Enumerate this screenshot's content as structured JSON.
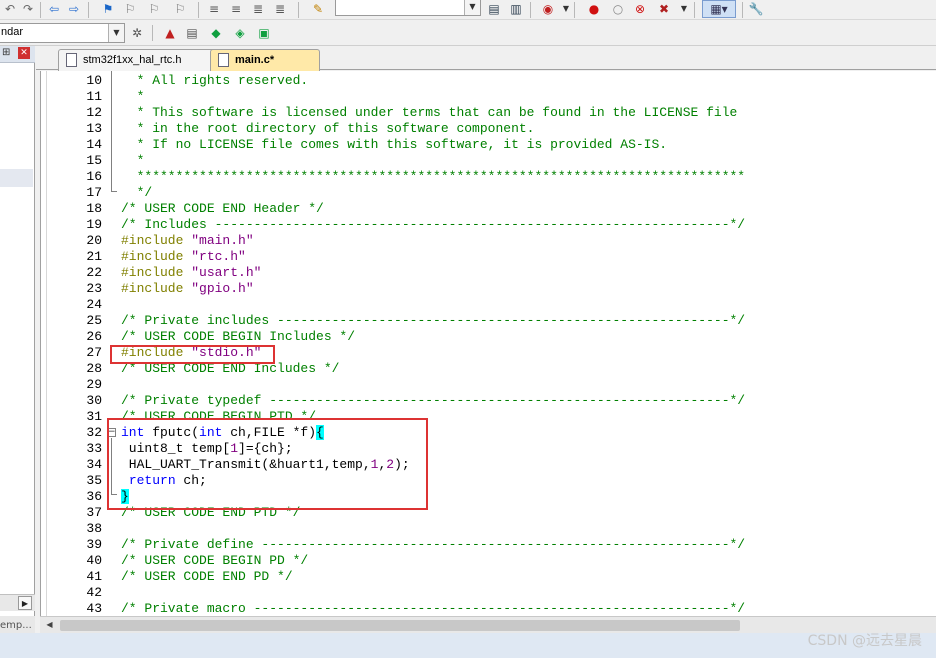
{
  "toolbar": {
    "target_combo": "ndar"
  },
  "tabs": [
    {
      "label": "stm32f1xx_hal_rtc.h"
    },
    {
      "label": "main.c*"
    }
  ],
  "left_panel": {
    "footer": "emp..."
  },
  "editor": {
    "lines": [
      {
        "n": "10",
        "code": [
          {
            "t": "  * All rights reserved.",
            "c": "c-cmt"
          }
        ]
      },
      {
        "n": "11",
        "code": [
          {
            "t": "  *",
            "c": "c-cmt"
          }
        ]
      },
      {
        "n": "12",
        "code": [
          {
            "t": "  * This software is licensed under terms that can be found in the LICENSE file",
            "c": "c-cmt"
          }
        ]
      },
      {
        "n": "13",
        "code": [
          {
            "t": "  * in the root directory of this software component.",
            "c": "c-cmt"
          }
        ]
      },
      {
        "n": "14",
        "code": [
          {
            "t": "  * If no LICENSE file comes with this software, it is provided AS-IS.",
            "c": "c-cmt"
          }
        ]
      },
      {
        "n": "15",
        "code": [
          {
            "t": "  *",
            "c": "c-cmt"
          }
        ]
      },
      {
        "n": "16",
        "code": [
          {
            "t": "  ******************************************************************************",
            "c": "c-cmt"
          }
        ]
      },
      {
        "n": "17",
        "code": [
          {
            "t": "  */",
            "c": "c-cmt"
          }
        ]
      },
      {
        "n": "18",
        "code": [
          {
            "t": "/* USER CODE END Header */",
            "c": "c-cmt"
          }
        ]
      },
      {
        "n": "19",
        "code": [
          {
            "t": "/* Includes ------------------------------------------------------------------*/",
            "c": "c-cmt"
          }
        ]
      },
      {
        "n": "20",
        "code": [
          {
            "t": "#include ",
            "c": "c-pp"
          },
          {
            "t": "\"main.h\"",
            "c": "c-str"
          }
        ]
      },
      {
        "n": "21",
        "code": [
          {
            "t": "#include ",
            "c": "c-pp"
          },
          {
            "t": "\"rtc.h\"",
            "c": "c-str"
          }
        ]
      },
      {
        "n": "22",
        "code": [
          {
            "t": "#include ",
            "c": "c-pp"
          },
          {
            "t": "\"usart.h\"",
            "c": "c-str"
          }
        ]
      },
      {
        "n": "23",
        "code": [
          {
            "t": "#include ",
            "c": "c-pp"
          },
          {
            "t": "\"gpio.h\"",
            "c": "c-str"
          }
        ]
      },
      {
        "n": "24",
        "code": []
      },
      {
        "n": "25",
        "code": [
          {
            "t": "/* Private includes ----------------------------------------------------------*/",
            "c": "c-cmt"
          }
        ]
      },
      {
        "n": "26",
        "code": [
          {
            "t": "/* USER CODE BEGIN Includes */",
            "c": "c-cmt"
          }
        ]
      },
      {
        "n": "27",
        "code": [
          {
            "t": "#include ",
            "c": "c-pp"
          },
          {
            "t": "\"stdio.h\"",
            "c": "c-str"
          }
        ]
      },
      {
        "n": "28",
        "code": [
          {
            "t": "/* USER CODE END Includes */",
            "c": "c-cmt"
          }
        ]
      },
      {
        "n": "29",
        "code": []
      },
      {
        "n": "30",
        "code": [
          {
            "t": "/* Private typedef -----------------------------------------------------------*/",
            "c": "c-cmt"
          }
        ]
      },
      {
        "n": "31",
        "code": [
          {
            "t": "/* USER CODE BEGIN PTD */",
            "c": "c-cmt"
          }
        ]
      },
      {
        "n": "32",
        "code": [
          {
            "t": "int",
            "c": "c-kw"
          },
          {
            "t": " fputc(",
            "c": ""
          },
          {
            "t": "int",
            "c": "c-kw"
          },
          {
            "t": " ch,FILE *f)",
            "c": ""
          },
          {
            "t": "{",
            "c": "c-br"
          }
        ]
      },
      {
        "n": "33",
        "code": [
          {
            "t": " uint8_t temp[",
            "c": ""
          },
          {
            "t": "1",
            "c": "c-num"
          },
          {
            "t": "]={ch};",
            "c": ""
          }
        ]
      },
      {
        "n": "34",
        "code": [
          {
            "t": " HAL_UART_Transmit(&huart1,temp,",
            "c": ""
          },
          {
            "t": "1",
            "c": "c-num"
          },
          {
            "t": ",",
            "c": ""
          },
          {
            "t": "2",
            "c": "c-num"
          },
          {
            "t": ");",
            "c": ""
          }
        ]
      },
      {
        "n": "35",
        "code": [
          {
            "t": " ",
            "c": ""
          },
          {
            "t": "return",
            "c": "c-kw"
          },
          {
            "t": " ch;",
            "c": ""
          }
        ]
      },
      {
        "n": "36",
        "code": [
          {
            "t": "}",
            "c": "c-br"
          }
        ]
      },
      {
        "n": "37",
        "code": [
          {
            "t": "/* USER CODE END PTD */",
            "c": "c-cmt"
          }
        ]
      },
      {
        "n": "38",
        "code": []
      },
      {
        "n": "39",
        "code": [
          {
            "t": "/* Private define ------------------------------------------------------------*/",
            "c": "c-cmt"
          }
        ]
      },
      {
        "n": "40",
        "code": [
          {
            "t": "/* USER CODE BEGIN PD */",
            "c": "c-cmt"
          }
        ]
      },
      {
        "n": "41",
        "code": [
          {
            "t": "/* USER CODE END PD */",
            "c": "c-cmt"
          }
        ]
      },
      {
        "n": "42",
        "code": []
      },
      {
        "n": "43",
        "code": [
          {
            "t": "/* Private macro -------------------------------------------------------------*/",
            "c": "c-cmt"
          }
        ]
      }
    ]
  },
  "watermark": "CSDN @远去星晨",
  "colors": {
    "annotation_box": "#dd3333",
    "active_tab": "#ffe9a8",
    "brace_highlight": "#00ffff"
  }
}
